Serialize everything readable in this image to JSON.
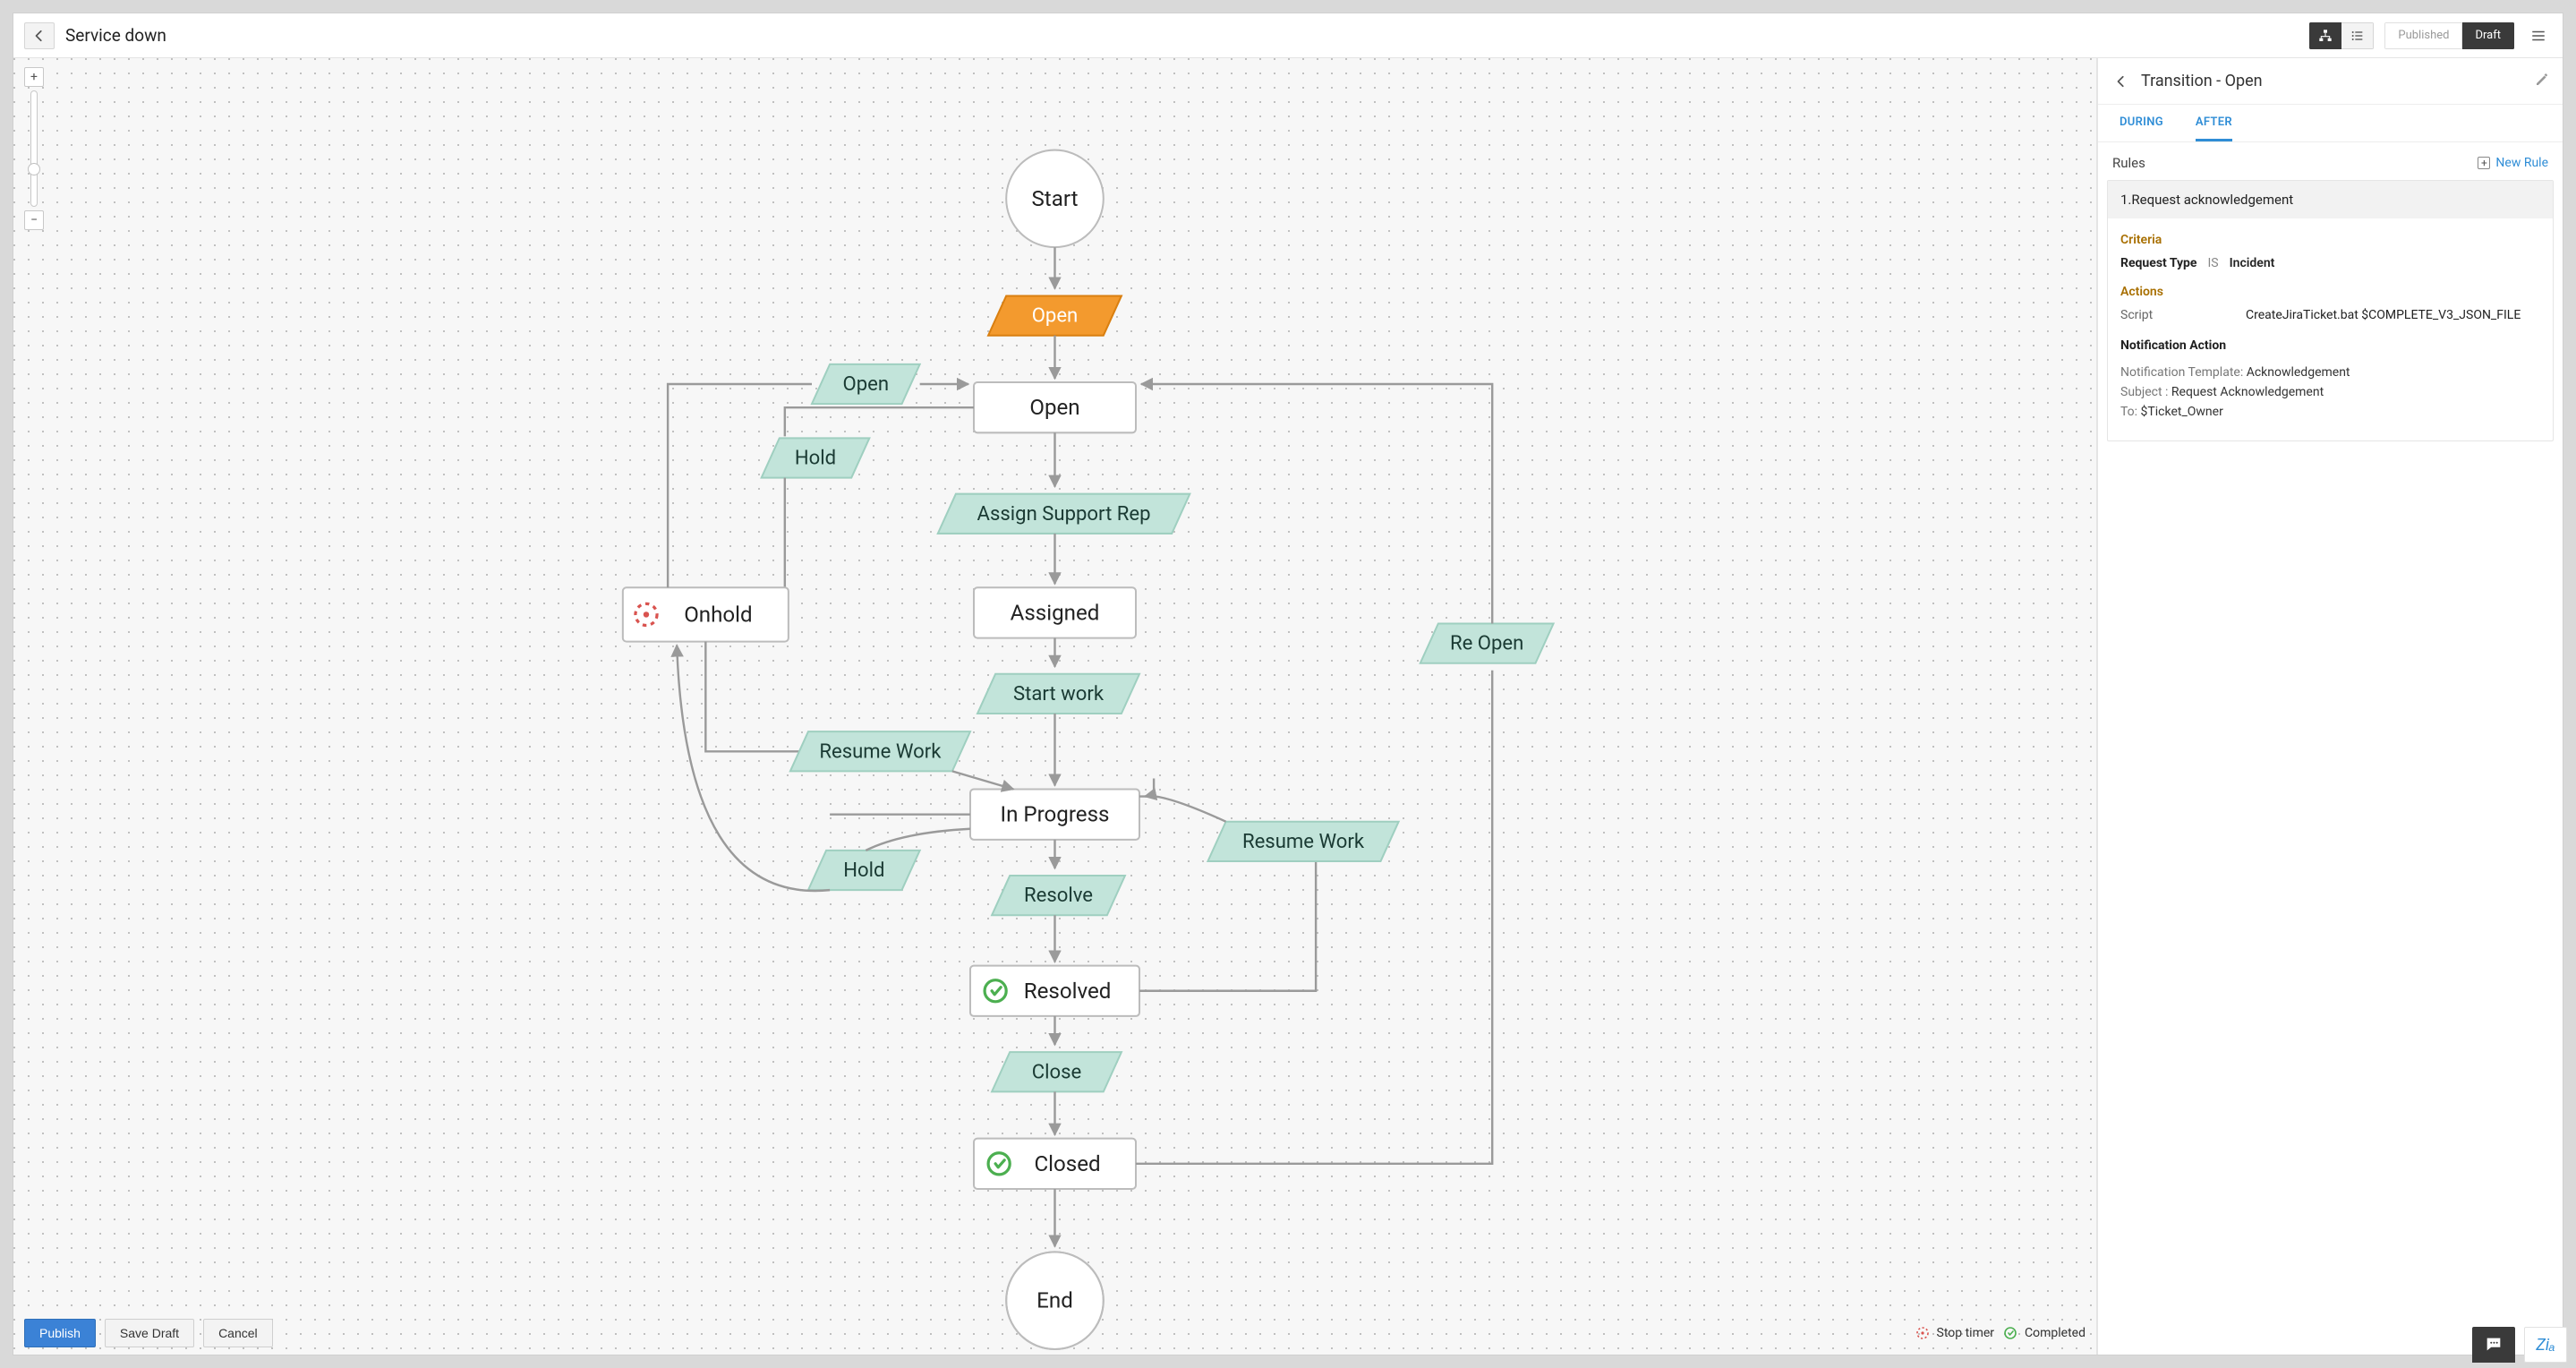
{
  "header": {
    "title": "Service down",
    "view_toggle": {
      "diagram": "diagram",
      "list": "list"
    },
    "status_toggle": {
      "published": "Published",
      "draft": "Draft"
    }
  },
  "canvas": {
    "start": "Start",
    "end": "End",
    "states": {
      "open": "Open",
      "onhold": "Onhold",
      "assigned": "Assigned",
      "in_progress": "In Progress",
      "resolved": "Resolved",
      "closed": "Closed"
    },
    "transitions": {
      "open_start": "Open",
      "open_back": "Open",
      "hold_from_open": "Hold",
      "assign_support": "Assign Support Rep",
      "start_work": "Start work",
      "resume_work_onhold": "Resume Work",
      "resume_work_resolved": "Resume Work",
      "re_open": "Re Open",
      "hold_from_inprogress": "Hold",
      "resolve": "Resolve",
      "close": "Close"
    },
    "footer": {
      "publish": "Publish",
      "save_draft": "Save Draft",
      "cancel": "Cancel",
      "stop_timer": "Stop timer",
      "completed": "Completed"
    }
  },
  "panel": {
    "title": "Transition - Open",
    "tabs": {
      "during": "DURING",
      "after": "AFTER"
    },
    "rules_label": "Rules",
    "new_rule": "New Rule",
    "rule": {
      "title": "1.Request acknowledgement",
      "criteria_label": "Criteria",
      "criteria_field": "Request Type",
      "criteria_op": "IS",
      "criteria_value": "Incident",
      "actions_label": "Actions",
      "action_label": "Script",
      "action_value": "CreateJiraTicket.bat $COMPLETE_V3_JSON_FILE",
      "notification_label": "Notification Action",
      "notif_template_label": "Notification Template: ",
      "notif_template_value": "Acknowledgement",
      "notif_subject_label": "Subject : ",
      "notif_subject_value": "Request Acknowledgement",
      "notif_to_label": "To: ",
      "notif_to_value": "$Ticket_Owner"
    }
  }
}
